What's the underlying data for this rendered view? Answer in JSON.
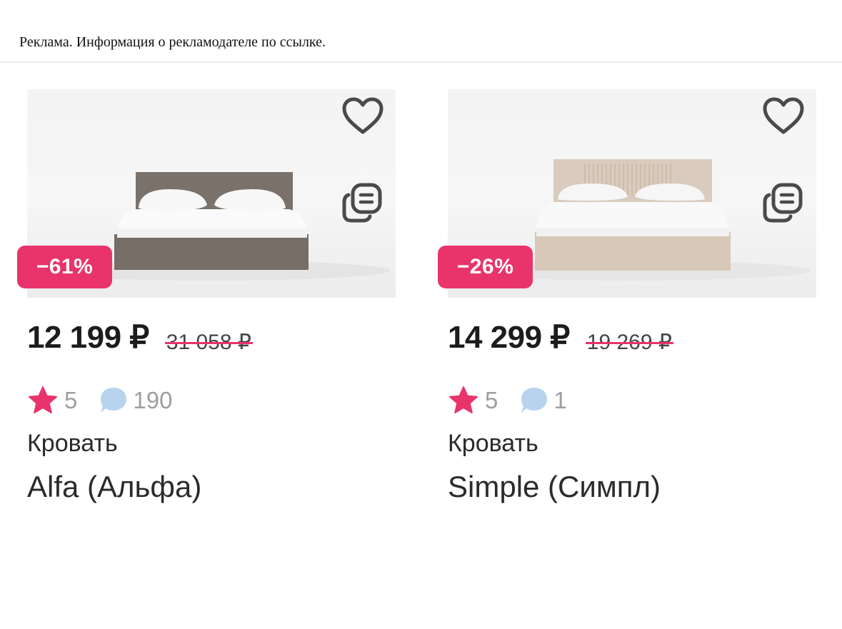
{
  "ad_notice": "Реклама. Информация о рекламодателе по ссылке.",
  "colors": {
    "accent": "#e8346a",
    "comment_icon": "#b8d3ee",
    "muted_text": "#9e9e9e"
  },
  "products": [
    {
      "discount": "−61%",
      "price": "12 199 ₽",
      "old_price": "31 058 ₽",
      "rating": "5",
      "reviews": "190",
      "category": "Кровать",
      "name": "Alfa (Альфа)",
      "bed_color": "brown-grey"
    },
    {
      "discount": "−26%",
      "price": "14 299 ₽",
      "old_price": "19 269 ₽",
      "rating": "5",
      "reviews": "1",
      "category": "Кровать",
      "name": "Simple (Симпл)",
      "bed_color": "beige"
    }
  ],
  "icons": [
    "heart-icon",
    "compare-icon",
    "star-icon",
    "comment-icon"
  ]
}
